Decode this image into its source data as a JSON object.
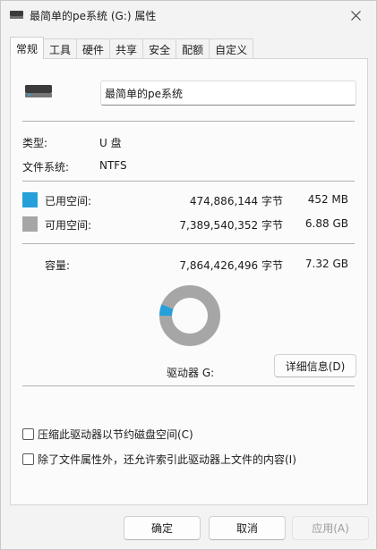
{
  "window": {
    "title": "最简单的pe系统 (G:) 属性"
  },
  "tabs": [
    {
      "label": "常规",
      "active": true
    },
    {
      "label": "工具"
    },
    {
      "label": "硬件"
    },
    {
      "label": "共享"
    },
    {
      "label": "安全"
    },
    {
      "label": "配额"
    },
    {
      "label": "自定义"
    }
  ],
  "general": {
    "volume_name": "最简单的pe系统",
    "type_label": "类型:",
    "type_value": "U 盘",
    "fs_label": "文件系统:",
    "fs_value": "NTFS",
    "used": {
      "label": "已用空间:",
      "bytes": "474,886,144 字节",
      "size": "452 MB",
      "color": "#26a0da"
    },
    "free": {
      "label": "可用空间:",
      "bytes": "7,389,540,352 字节",
      "size": "6.88 GB",
      "color": "#a6a6a6"
    },
    "capacity": {
      "label": "容量:",
      "bytes": "7,864,426,496 字节",
      "size": "7.32 GB"
    },
    "used_fraction": 0.0604,
    "drive_label": "驱动器 G:",
    "details_button": "详细信息(D)",
    "compress_option": "压缩此驱动器以节约磁盘空间(C)",
    "index_option": "除了文件属性外，还允许索引此驱动器上文件的内容(I)"
  },
  "footer": {
    "ok": "确定",
    "cancel": "取消",
    "apply": "应用(A)"
  },
  "colors": {
    "accent": "#26a0da",
    "free_gray": "#a6a6a6"
  }
}
